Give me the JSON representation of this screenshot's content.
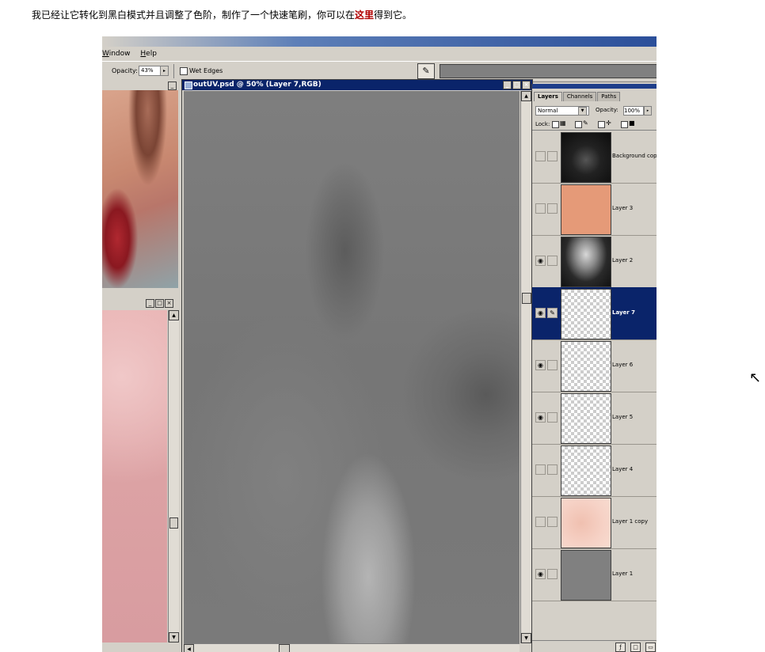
{
  "caption": {
    "text_before": "我已经让它转化到黑白模式并且调整了色阶，制作了一个快速笔刷，你可以在",
    "link_text": "这里",
    "text_after": "得到它。"
  },
  "photoshop": {
    "menu": [
      {
        "label": "Window",
        "underline": "W"
      },
      {
        "label": "Help",
        "underline": "H"
      }
    ],
    "options_bar": {
      "opacity_label": "Opacity:",
      "opacity_value": "43%",
      "wet_edges_label": "Wet Edges",
      "wet_edges_checked": false
    },
    "document": {
      "title": "outUV.psd @ 50% (Layer 7,RGB)"
    },
    "layers_panel": {
      "tabs": [
        "Layers",
        "Channels",
        "Paths"
      ],
      "active_tab": "Layers",
      "blend_mode": "Normal",
      "opacity_label": "Opacity:",
      "opacity_value": "100%",
      "lock_label": "Lock:",
      "layers": [
        {
          "name": "Background copy",
          "visible": false,
          "selected": false,
          "thumb": "dark-texture"
        },
        {
          "name": "Layer 3",
          "visible": false,
          "selected": false,
          "thumb": "solid-peach",
          "thumb_color": "#e59a78"
        },
        {
          "name": "Layer 2",
          "visible": true,
          "selected": false,
          "thumb": "head-render"
        },
        {
          "name": "Layer 7",
          "visible": true,
          "selected": true,
          "thumb": "transparent"
        },
        {
          "name": "Layer 6",
          "visible": true,
          "selected": false,
          "thumb": "transparent"
        },
        {
          "name": "Layer 5",
          "visible": true,
          "selected": false,
          "thumb": "transparent"
        },
        {
          "name": "Layer 4",
          "visible": false,
          "selected": false,
          "thumb": "transparent"
        },
        {
          "name": "Layer 1 copy",
          "visible": false,
          "selected": false,
          "thumb": "skin-face"
        },
        {
          "name": "Layer 1",
          "visible": true,
          "selected": false,
          "thumb": "solid-gray",
          "thumb_color": "#808080"
        }
      ]
    }
  },
  "colors": {
    "title_active": "#0a246a",
    "panel_bg": "#d4d0c8",
    "link_red": "#b00000"
  }
}
